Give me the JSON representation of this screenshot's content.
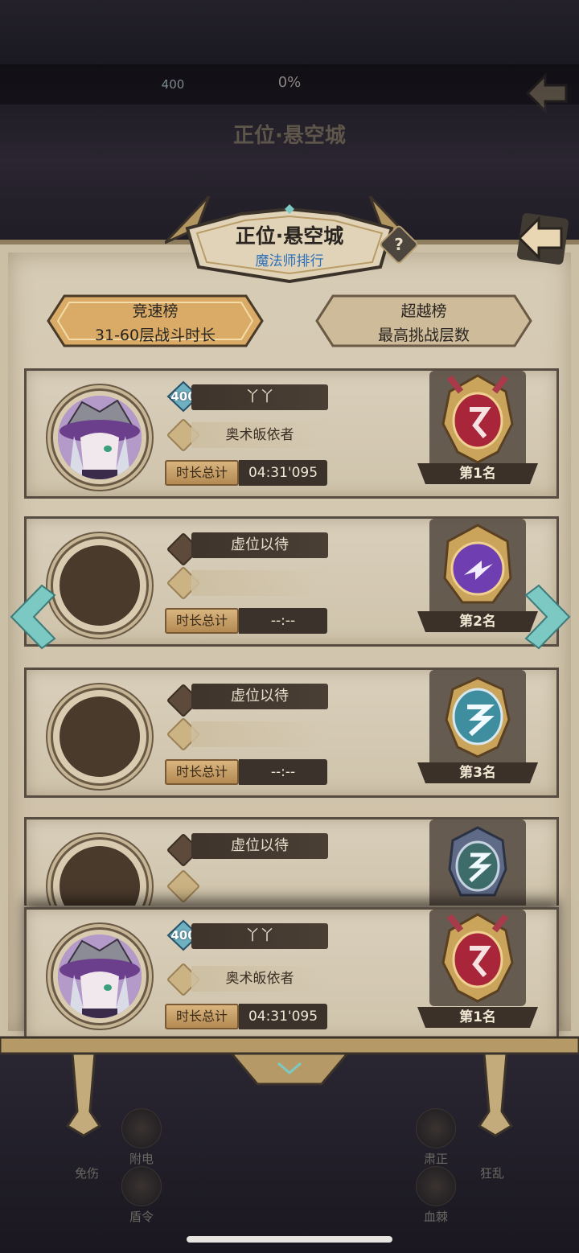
{
  "background": {
    "level": "400",
    "progress": "0%",
    "title": "正位·悬空城",
    "help": "?"
  },
  "header": {
    "title": "正位·悬空城",
    "subtitle": "魔法师排行",
    "help": "?"
  },
  "tabs": [
    {
      "line1": "竞速榜",
      "line2": "31-60层战斗时长",
      "active": true
    },
    {
      "line1": "超越榜",
      "line2": "最高挑战层数",
      "active": false
    }
  ],
  "rows": [
    {
      "level": "400",
      "name": "丫丫",
      "title": "奥术皈依者",
      "time_label": "时长总计",
      "time": "04:31'095",
      "rank": "第1名"
    },
    {
      "name": "虚位以待",
      "time_label": "时长总计",
      "time": "--:--",
      "rank": "第2名"
    },
    {
      "name": "虚位以待",
      "time_label": "时长总计",
      "time": "--:--",
      "rank": "第3名"
    },
    {
      "name": "虚位以待"
    }
  ],
  "my_row": {
    "level": "400",
    "name": "丫丫",
    "title": "奥术皈依者",
    "time_label": "时长总计",
    "time": "04:31'095",
    "rank": "第1名"
  },
  "skills": [
    {
      "label": "附电"
    },
    {
      "label": "肃正"
    },
    {
      "label": "免伤"
    },
    {
      "label": "狂乱"
    },
    {
      "label": "盾令"
    },
    {
      "label": "血棘"
    }
  ],
  "icons": {
    "back": "back-arrow-icon",
    "nav_left": "chevron-left-icon",
    "nav_right": "chevron-right-icon"
  },
  "colors": {
    "panel": "#cbbfa6",
    "row_border": "#574c41",
    "subtitle": "#2d6fb8",
    "rank_gold": "#c9a45a",
    "teal": "#7cc9c4"
  }
}
